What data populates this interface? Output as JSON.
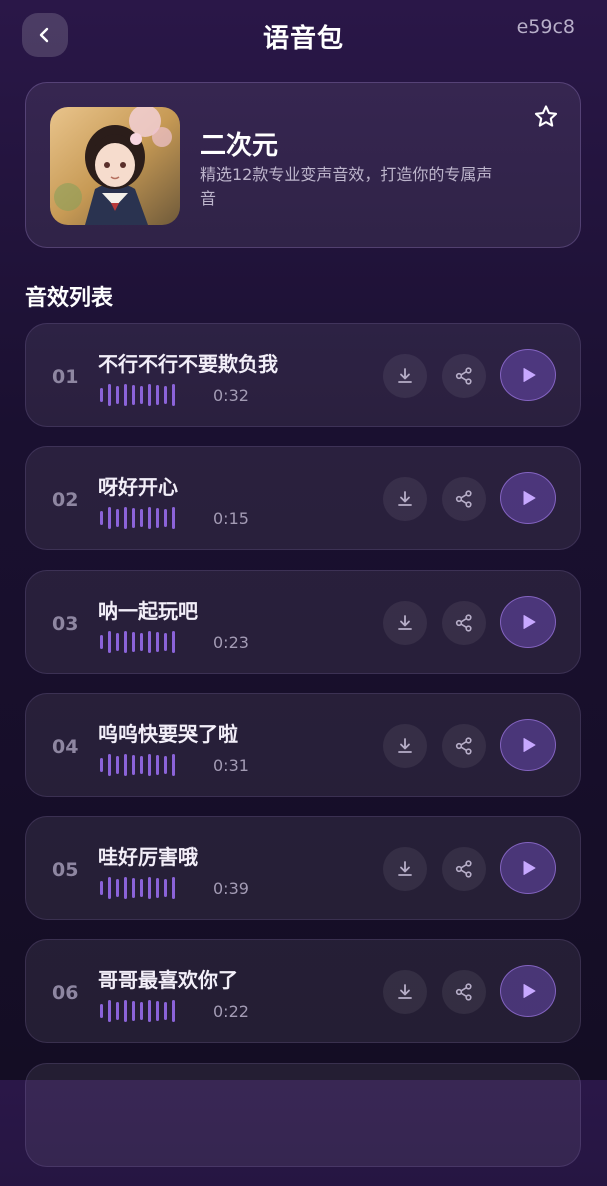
{
  "header": {
    "title": "语音包",
    "code": "e59c8"
  },
  "pack": {
    "name": "二次元",
    "description": "精选12款专业变声音效，打造你的专属声音"
  },
  "section_title": "音效列表",
  "colors": {
    "accent": "#8b63d9",
    "background": "#1a1030"
  },
  "icons": [
    "back-arrow-icon",
    "star-icon",
    "download-icon",
    "share-icon",
    "play-icon",
    "waveform-icon"
  ],
  "sounds": [
    {
      "num": "01",
      "name": "不行不行不要欺负我",
      "duration": "0:32"
    },
    {
      "num": "02",
      "name": "呀好开心",
      "duration": "0:15"
    },
    {
      "num": "03",
      "name": "呐一起玩吧",
      "duration": "0:23"
    },
    {
      "num": "04",
      "name": "呜呜快要哭了啦",
      "duration": "0:31"
    },
    {
      "num": "05",
      "name": "哇好厉害哦",
      "duration": "0:39"
    },
    {
      "num": "06",
      "name": "哥哥最喜欢你了",
      "duration": "0:22"
    },
    {
      "num": "",
      "name": "",
      "duration": ""
    }
  ]
}
